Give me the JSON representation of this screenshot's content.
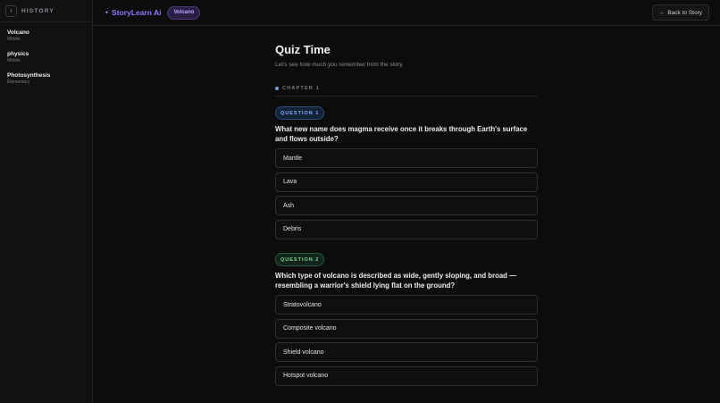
{
  "sidebar": {
    "collapse_glyph": "‹",
    "title": "HISTORY",
    "items": [
      {
        "name": "Volcano",
        "level": "Middle"
      },
      {
        "name": "physics",
        "level": "Middle"
      },
      {
        "name": "Photosynthesis",
        "level": "Elementary"
      }
    ]
  },
  "topbar": {
    "brand": "StoryLearn Ai",
    "brand_icon": "sparkle-dot",
    "topic": "Volcano",
    "back_label": "Back to Story",
    "back_icon": "arrow-left-icon"
  },
  "quiz": {
    "title": "Quiz Time",
    "subtitle": "Let's see how much you remember from the story.",
    "chapter": "CHAPTER 1",
    "questions": [
      {
        "badge": "QUESTION 1",
        "text": "What new name does magma receive once it breaks through Earth's surface and flows outside?",
        "options": [
          "Mantle",
          "Lava",
          "Ash",
          "Debris"
        ]
      },
      {
        "badge": "QUESTION 2",
        "text": "Which type of volcano is described as wide, gently sloping, and broad — resembling a warrior's shield lying flat on the ground?",
        "options": [
          "Stratovolcano",
          "Composite volcano",
          "Shield volcano",
          "Hotspot volcano"
        ]
      }
    ]
  },
  "colors": {
    "accent": "#8b7cff",
    "q1_accent": "#7fb0ff",
    "q2_accent": "#7fd69b",
    "background": "#0c0c0d"
  }
}
